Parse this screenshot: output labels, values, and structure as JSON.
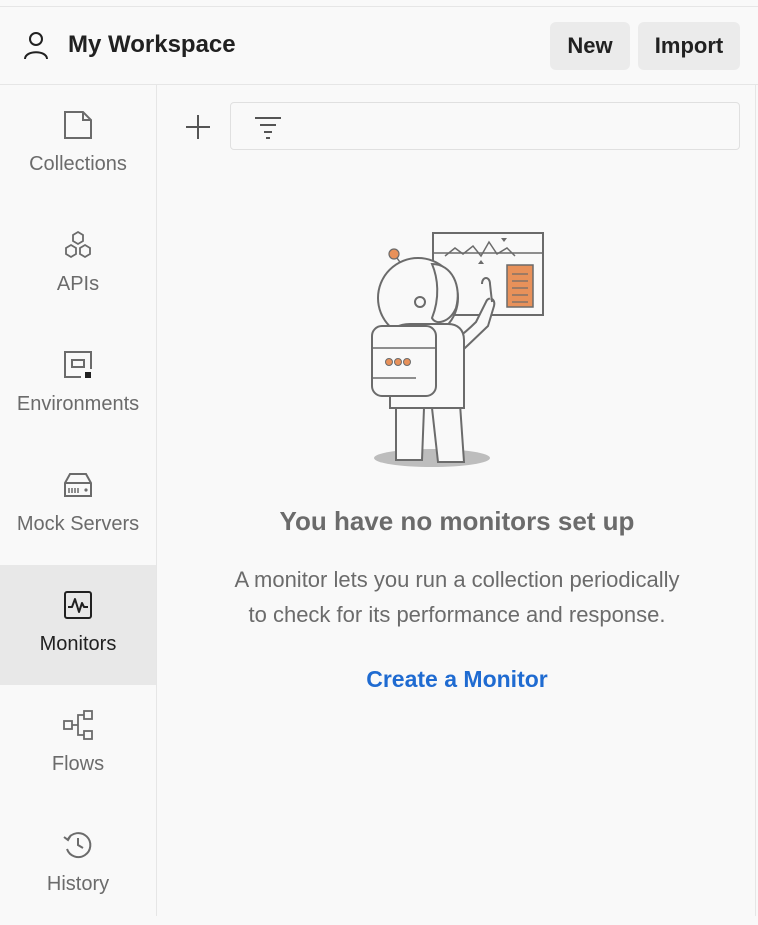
{
  "header": {
    "workspace_title": "My Workspace",
    "new_label": "New",
    "import_label": "Import"
  },
  "sidebar": {
    "items": [
      {
        "label": "Collections",
        "icon": "collections-icon"
      },
      {
        "label": "APIs",
        "icon": "apis-icon"
      },
      {
        "label": "Environments",
        "icon": "environments-icon"
      },
      {
        "label": "Mock Servers",
        "icon": "mock-servers-icon"
      },
      {
        "label": "Monitors",
        "icon": "monitors-icon",
        "active": true
      },
      {
        "label": "Flows",
        "icon": "flows-icon"
      },
      {
        "label": "History",
        "icon": "history-icon"
      }
    ]
  },
  "main": {
    "empty_title": "You have no monitors set up",
    "empty_desc_line1": "A monitor lets you run a collection periodically",
    "empty_desc_line2": "to check for its performance and response.",
    "create_link": "Create a Monitor"
  },
  "colors": {
    "link": "#1f6bd1",
    "accent_orange": "#e8915a",
    "active_bg": "#e8e8e8"
  }
}
